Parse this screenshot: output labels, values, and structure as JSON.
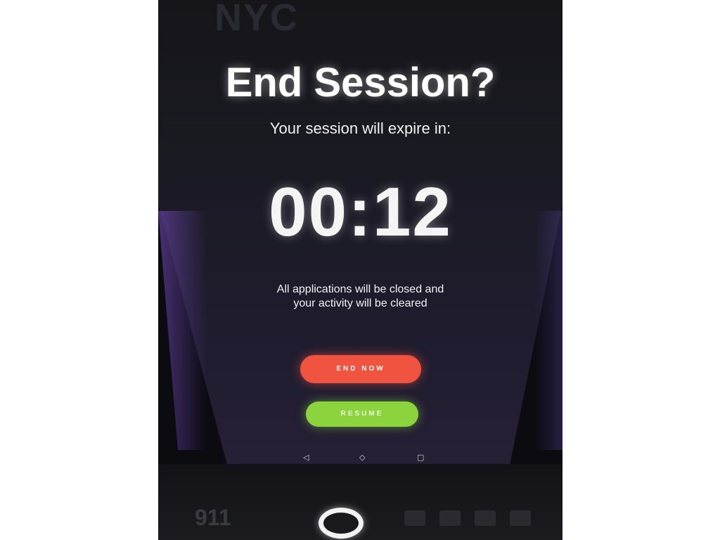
{
  "bezel": {
    "top_text": "NYC",
    "bottom_text": "911"
  },
  "dialog": {
    "title": "End Session?",
    "subtitle": "Your session will expire in:",
    "timer": "00:12",
    "note_line1": "All applications will be closed and",
    "note_line2": "your activity will be cleared"
  },
  "buttons": {
    "end_now": "END NOW",
    "resume": "RESUME"
  },
  "navbar": {
    "back_icon": "◁",
    "home_icon": "◇",
    "recent_icon": "▢"
  },
  "colors": {
    "end_button": "#f0533f",
    "resume_button": "#8bd43d"
  }
}
